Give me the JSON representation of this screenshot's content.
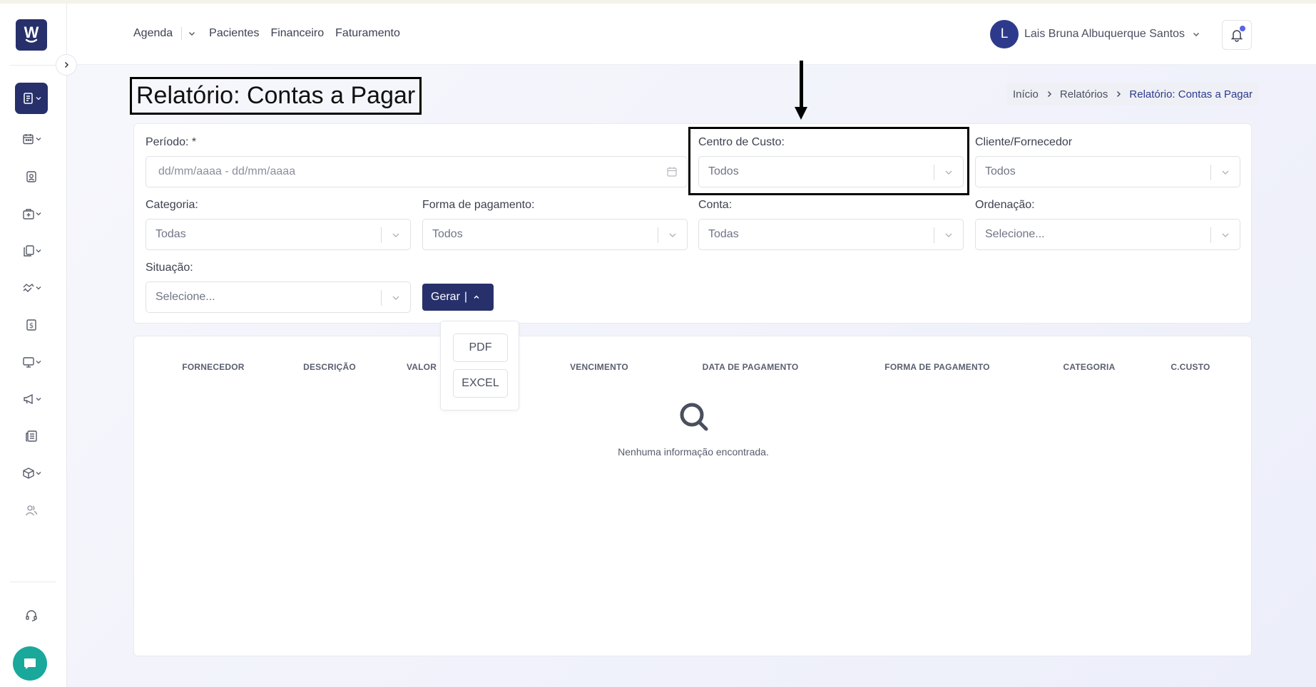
{
  "app": {
    "logo_letter": "W"
  },
  "sidebar": {
    "items": [
      {
        "icon": "report-icon",
        "active": true,
        "has_chevron": true
      },
      {
        "icon": "calendar-icon",
        "active": false,
        "has_chevron": true
      },
      {
        "icon": "patient-badge-icon",
        "active": false,
        "has_chevron": false
      },
      {
        "icon": "medical-bag-icon",
        "active": false,
        "has_chevron": true
      },
      {
        "icon": "documents-icon",
        "active": false,
        "has_chevron": true
      },
      {
        "icon": "handshake-icon",
        "active": false,
        "has_chevron": true
      },
      {
        "icon": "dollar-document-icon",
        "active": false,
        "has_chevron": false
      },
      {
        "icon": "monitor-icon",
        "active": false,
        "has_chevron": true
      },
      {
        "icon": "megaphone-icon",
        "active": false,
        "has_chevron": true
      },
      {
        "icon": "newspaper-icon",
        "active": false,
        "has_chevron": false
      },
      {
        "icon": "box-icon",
        "active": false,
        "has_chevron": true
      },
      {
        "icon": "users-icon",
        "active": false,
        "has_chevron": false
      }
    ],
    "support_icon": "headset-icon",
    "chat_icon": "chat-bubble-icon"
  },
  "topnav": {
    "items": [
      "Agenda",
      "Pacientes",
      "Financeiro",
      "Faturamento"
    ],
    "user_initial": "L",
    "user_name": "Lais Bruna Albuquerque Santos"
  },
  "page": {
    "title": "Relatório: Contas a Pagar",
    "breadcrumb": [
      "Início",
      "Relatórios",
      "Relatório: Contas a Pagar"
    ]
  },
  "filters": {
    "periodo": {
      "label": "Período: *",
      "placeholder": "dd/mm/aaaa - dd/mm/aaaa"
    },
    "centro_custo": {
      "label": "Centro de Custo:",
      "value": "Todos"
    },
    "cliente_fornecedor": {
      "label": "Cliente/Fornecedor",
      "value": "Todos"
    },
    "categoria": {
      "label": "Categoria:",
      "value": "Todas"
    },
    "forma_pagamento": {
      "label": "Forma de pagamento:",
      "value": "Todos"
    },
    "conta": {
      "label": "Conta:",
      "value": "Todas"
    },
    "ordenacao": {
      "label": "Ordenação:",
      "value": "Selecione..."
    },
    "situacao": {
      "label": "Situação:",
      "value": "Selecione..."
    },
    "generate_label": "Gerar",
    "generate_separator": "|",
    "export_options": [
      "PDF",
      "EXCEL"
    ]
  },
  "table": {
    "columns": [
      "FORNECEDOR",
      "DESCRIÇÃO",
      "VALOR",
      "VENCIMENTO",
      "DATA DE PAGAMENTO",
      "FORMA DE PAGAMENTO",
      "CATEGORIA",
      "C.CUSTO"
    ],
    "empty_message": "Nenhuma informação encontrada."
  },
  "colors": {
    "primary": "#27306b",
    "accent": "#2d3a8c",
    "chat": "#1aa89a",
    "notification_dot": "#5b63e6"
  }
}
